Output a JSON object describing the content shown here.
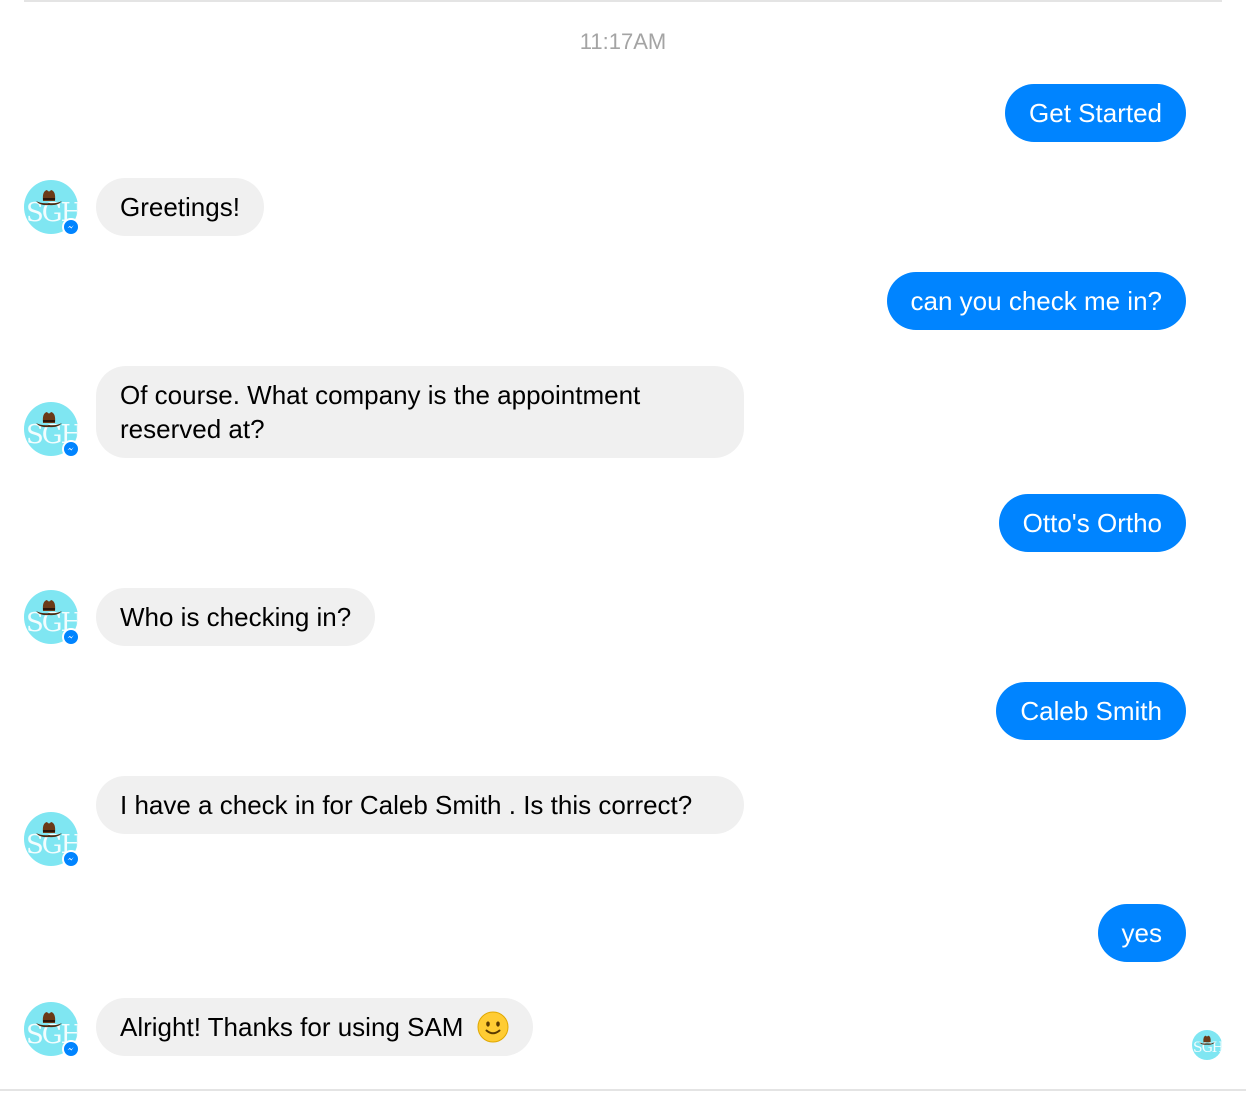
{
  "conversation": {
    "timestamp": "11:17AM",
    "messages": [
      {
        "from": "user",
        "text": "Get Started"
      },
      {
        "from": "bot",
        "text": "Greetings!"
      },
      {
        "from": "user",
        "text": "can you check me in?"
      },
      {
        "from": "bot",
        "text": "Of course. What company is the appointment reserved at?"
      },
      {
        "from": "user",
        "text": "Otto's Ortho"
      },
      {
        "from": "bot",
        "text": "Who is checking in?"
      },
      {
        "from": "user",
        "text": "Caleb Smith"
      },
      {
        "from": "bot",
        "text": "I have a check in for Caleb Smith . Is this correct?"
      },
      {
        "from": "user",
        "text": "yes"
      },
      {
        "from": "bot",
        "text": "Alright! Thanks for using SAM",
        "emoji": "slightly-smiling-face-icon"
      }
    ]
  },
  "bot_avatar": {
    "letters": "SGH",
    "icon": "cowboy-hat-icon",
    "badge": "messenger-icon",
    "color": "#7fe6f2"
  },
  "colors": {
    "outgoing_bubble": "#0084ff",
    "incoming_bubble": "#f0f0f0",
    "timestamp": "#a4a4a4"
  }
}
